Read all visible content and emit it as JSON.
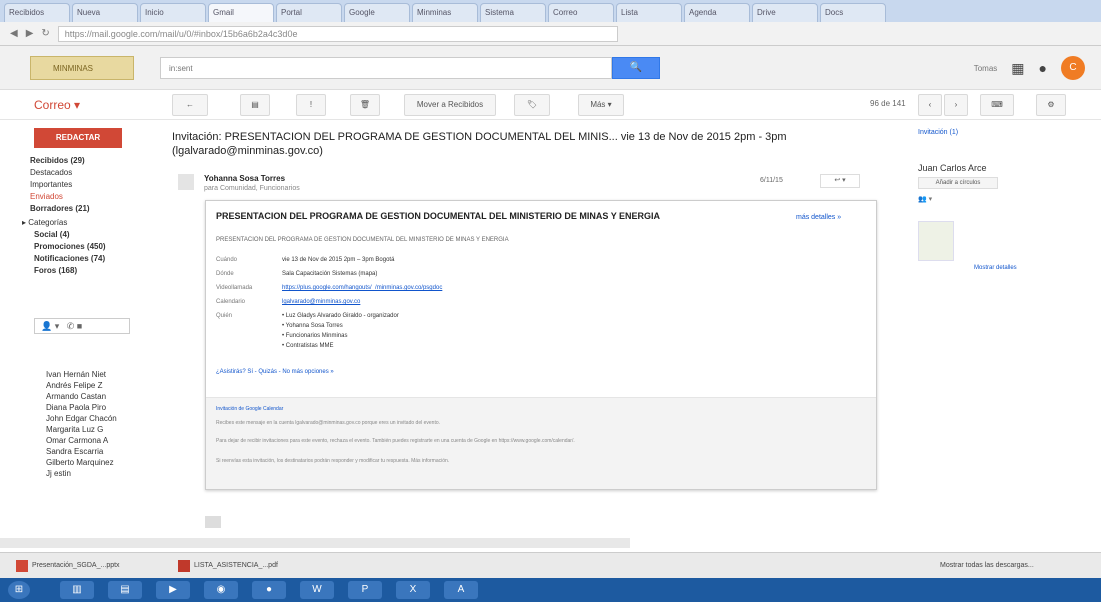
{
  "address": {
    "url": "https://mail.google.com/mail/u/0/#inbox/15b6a6b2a4c3d0e"
  },
  "header": {
    "logo_text": "MINMINAS",
    "search_value": "in:sent",
    "search_button": "🔍",
    "right_label": "Tomas",
    "avatar_letter": "C"
  },
  "toolbar": {
    "app_label": "Correo ▾",
    "move_label": "Mover a Recibidos",
    "more_label": "Más ▾",
    "pager": "96 de 141"
  },
  "sidebar": {
    "compose": "REDACTAR",
    "items": [
      {
        "label": "Recibidos (29)"
      },
      {
        "label": "Destacados"
      },
      {
        "label": "Importantes"
      },
      {
        "label": "Enviados"
      },
      {
        "label": "Borradores (21)"
      },
      {
        "label": "▸ Categorías"
      },
      {
        "label": "Social (4)"
      },
      {
        "label": "Promociones (450)"
      },
      {
        "label": "Notificaciones (74)"
      },
      {
        "label": "Foros (168)"
      }
    ],
    "contacts": [
      "Ivan Hernán Niet",
      "Andrés Felipe Z",
      "Armando Castan",
      "Diana Paola Piro",
      "John Edgar Chacón",
      "Margarita Luz G",
      "Omar Carmona A",
      "Sandra Escarria",
      "Gilberto Marquinez",
      "Jj estin"
    ]
  },
  "email": {
    "subject": "Invitación: PRESENTACION DEL PROGRAMA DE GESTION DOCUMENTAL DEL MINIS... vie 13 de Nov de 2015 2pm - 3pm (lgalvarado@minminas.gov.co)",
    "sender_name": "Yohanna Sosa Torres",
    "sender_to": "para Comunidad, Funcionarios",
    "date": "6/11/15",
    "card": {
      "title": "PRESENTACION DEL PROGRAMA DE GESTION DOCUMENTAL DEL MINISTERIO DE MINAS Y ENERGIA",
      "more_link": "más detalles »",
      "subtitle": "PRESENTACION DEL PROGRAMA DE GESTION DOCUMENTAL DEL MINISTERIO DE MINAS Y ENERGIA",
      "rows": [
        {
          "label": "Cuándo",
          "value": "vie 13 de Nov de 2015 2pm – 3pm Bogotá"
        },
        {
          "label": "Dónde",
          "value": "Sala Capacitación Sistemas (mapa)"
        },
        {
          "label": "Videollamada",
          "value": "https://plus.google.com/hangouts/_/minminas.gov.co/psgdoc"
        },
        {
          "label": "Calendario",
          "value": "lgalvarado@minminas.gov.co"
        },
        {
          "label": "Quién",
          "value": "• Luz Gladys Alvarado Giraldo - organizador"
        }
      ],
      "who_extra": [
        "• Yohanna Sosa Torres",
        "• Funcionarios Minminas",
        "• Contratistas MME"
      ],
      "rsvp": "¿Asistirás?  Sí - Quizás - No   más opciones »",
      "footer": [
        "Invitación de Google Calendar",
        "Recibes este mensaje en la cuenta lgalvarado@minminas.gov.co porque eres un invitado del evento.",
        "Para dejar de recibir invitaciones para este evento, rechaza el evento. También puedes registrarte en una cuenta de Google en https://www.google.com/calendar/.",
        "Si reenvías esta invitación, los destinatarios podrán responder y modificar tu respuesta. Más información."
      ]
    }
  },
  "right_panel": {
    "header": "Invitación (1)",
    "name": "Juan Carlos Arce",
    "add_circle": "Añadir a círculos",
    "count": "Mostrar detalles"
  },
  "downloads": [
    {
      "label": "Presentación_SGDA_...pptx"
    },
    {
      "label": "LISTA_ASISTENCIA_...pdf"
    }
  ],
  "downloads_right": "Mostrar todas las descargas..."
}
